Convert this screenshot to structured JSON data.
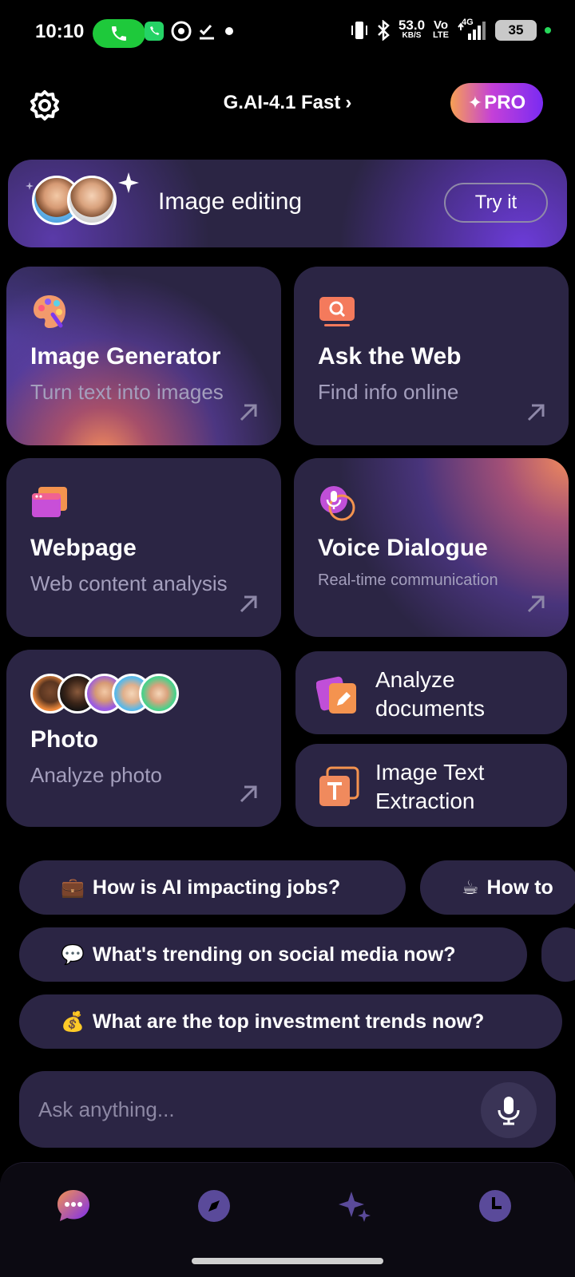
{
  "status_bar": {
    "time": "10:10",
    "net_speed_value": "53.0",
    "net_speed_unit": "KB/S",
    "volte_top": "Vo",
    "volte_bottom": "LTE",
    "signal": "4G",
    "battery": "35"
  },
  "header": {
    "model_name": "G.AI-4.1 Fast",
    "model_chevron": "›",
    "pro_label": "PRO",
    "pro_sparkle": "✦"
  },
  "banner": {
    "title": "Image editing",
    "cta_label": "Try it"
  },
  "cards": [
    {
      "title": "Image Generator",
      "subtitle": "Turn text into images"
    },
    {
      "title": "Ask the Web",
      "subtitle": "Find info online"
    },
    {
      "title": "Webpage",
      "subtitle": "Web content analysis"
    },
    {
      "title": "Voice Dialogue",
      "subtitle": "Real-time communication"
    },
    {
      "title": "Photo",
      "subtitle": "Analyze photo"
    }
  ],
  "small_cards": [
    {
      "line1": "Analyze",
      "line2": "documents"
    },
    {
      "line1": "Image Text",
      "line2": "Extraction"
    }
  ],
  "suggestions": [
    {
      "emoji": "💼",
      "text": "How is AI impacting jobs?"
    },
    {
      "emoji": "☕",
      "text": "How to"
    },
    {
      "emoji": "💬",
      "text": "What's trending on social media now?"
    },
    {
      "emoji": "💰",
      "text": "What are the top investment trends now?"
    }
  ],
  "input": {
    "placeholder": "Ask anything..."
  },
  "colors": {
    "background": "#000000",
    "card": "#2b2544",
    "accent_purple": "#7a2bf2",
    "accent_orange": "#f7a054",
    "call_green": "#1ec93b"
  }
}
